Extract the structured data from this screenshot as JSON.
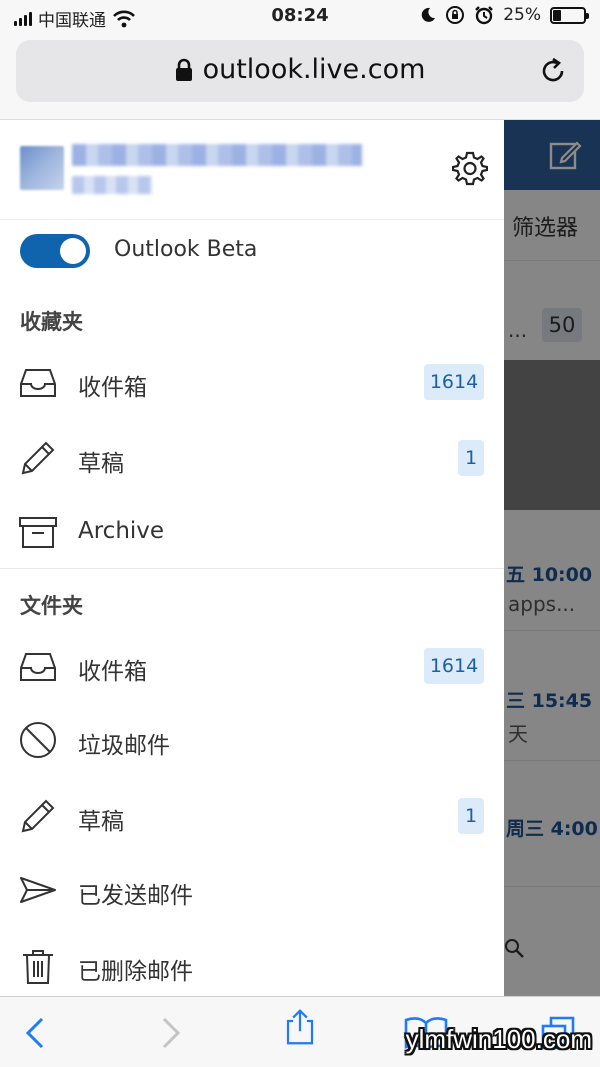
{
  "status_bar": {
    "carrier": "中国联通",
    "time": "08:24",
    "battery": "25%",
    "battery_level": 0.25,
    "icons": [
      "signal-icon",
      "wifi-icon",
      "moon-icon",
      "orientation-lock-icon",
      "alarm-icon",
      "battery-icon"
    ]
  },
  "browser": {
    "url": "outlook.live.com",
    "icons": [
      "lock-icon",
      "reload-icon"
    ]
  },
  "drawer": {
    "settings_icon": "gear-icon",
    "beta": {
      "label": "Outlook Beta",
      "enabled": true
    },
    "favorites": {
      "heading": "收藏夹",
      "items": [
        {
          "label": "收件箱",
          "badge": "1614",
          "icon": "inbox-icon"
        },
        {
          "label": "草稿",
          "badge": "1",
          "icon": "pencil-icon"
        },
        {
          "label": "Archive",
          "badge": "",
          "icon": "archive-icon"
        }
      ]
    },
    "folders": {
      "heading": "文件夹",
      "items": [
        {
          "label": "收件箱",
          "badge": "1614",
          "icon": "inbox-icon"
        },
        {
          "label": "垃圾邮件",
          "badge": "",
          "icon": "blocked-icon"
        },
        {
          "label": "草稿",
          "badge": "1",
          "icon": "pencil-icon"
        },
        {
          "label": "已发送邮件",
          "badge": "",
          "icon": "send-icon"
        },
        {
          "label": "已删除邮件",
          "badge": "",
          "icon": "trash-icon"
        }
      ]
    }
  },
  "mail_list": {
    "filter": "筛选器",
    "ellipsis": "...",
    "count_badge": "50",
    "rows": [
      {
        "time": "五 10:00",
        "snippet": "apps..."
      },
      {
        "time": "三 15:45",
        "snippet": "天"
      },
      {
        "time": "周三 4:00",
        "snippet": ""
      }
    ]
  },
  "toolbar": {
    "icons": [
      "back-icon",
      "forward-icon",
      "share-icon",
      "bookmarks-icon",
      "tabs-icon"
    ]
  },
  "watermark": "ylmfwin100.com"
}
